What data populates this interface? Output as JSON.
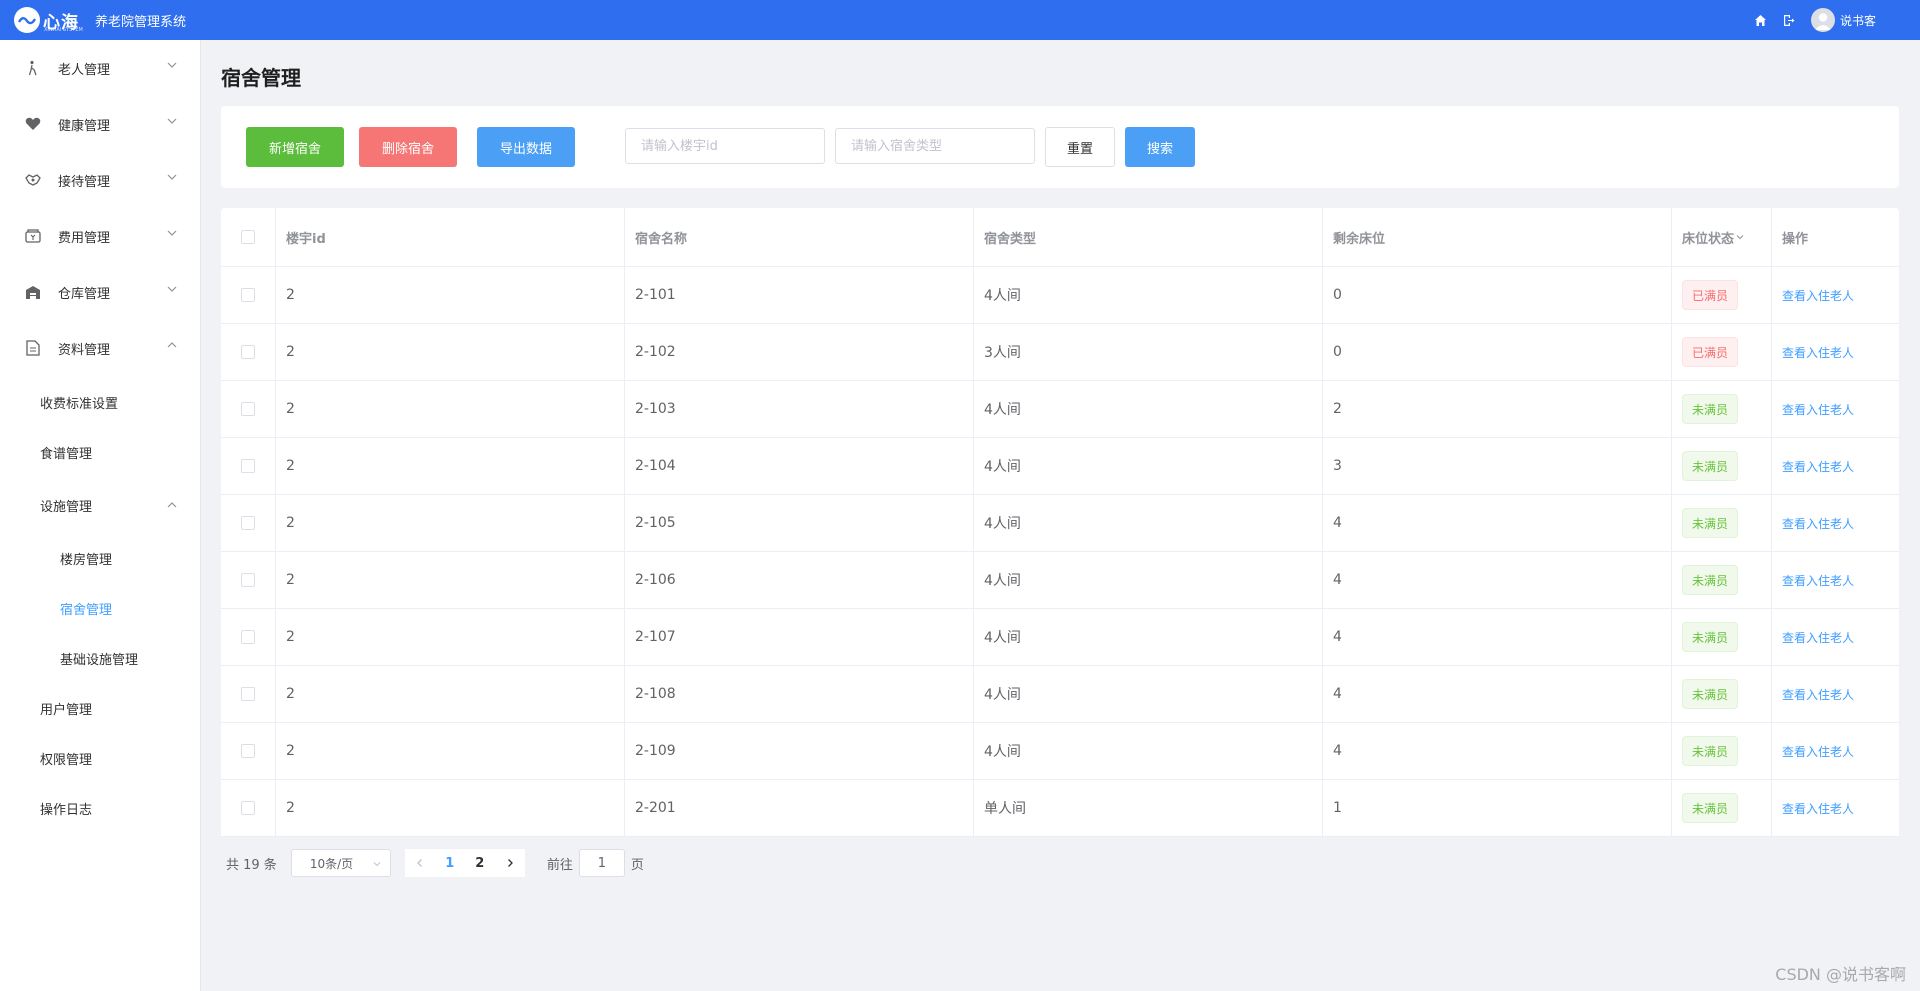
{
  "header": {
    "logo_text": "心海",
    "logo_sub": "XINHAI SYSTEM",
    "system_title": "养老院管理系统",
    "username": "说书客",
    "bg_color": "#2f6fef"
  },
  "sidebar": {
    "menus": [
      {
        "label": "老人管理",
        "icon": "elder-icon"
      },
      {
        "label": "健康管理",
        "icon": "heart-icon"
      },
      {
        "label": "接待管理",
        "icon": "handshake-icon"
      },
      {
        "label": "费用管理",
        "icon": "wallet-icon"
      },
      {
        "label": "仓库管理",
        "icon": "warehouse-icon"
      },
      {
        "label": "资料管理",
        "icon": "document-icon"
      }
    ],
    "sub_items": {
      "fee_standard": "收费标准设置",
      "recipe": "食谱管理",
      "facility": "设施管理",
      "building": "楼房管理",
      "dorm": "宿舍管理",
      "basic_facility": "基础设施管理",
      "user": "用户管理",
      "permission": "权限管理",
      "oplog": "操作日志"
    }
  },
  "page": {
    "title": "宿舍管理"
  },
  "toolbar": {
    "add_label": "新增宿舍",
    "delete_label": "删除宿舍",
    "export_label": "导出数据",
    "building_placeholder": "请输入楼宇id",
    "type_placeholder": "请输入宿舍类型",
    "reset_label": "重置",
    "search_label": "搜索"
  },
  "table": {
    "headers": {
      "building_id": "楼宇id",
      "name": "宿舍名称",
      "type": "宿舍类型",
      "beds_left": "剩余床位",
      "status": "床位状态",
      "action": "操作"
    },
    "action_label": "查看入住老人",
    "rows": [
      {
        "building_id": "2",
        "name": "2-101",
        "type": "4人间",
        "beds_left": "0",
        "status": "已满员",
        "full": true
      },
      {
        "building_id": "2",
        "name": "2-102",
        "type": "3人间",
        "beds_left": "0",
        "status": "已满员",
        "full": true
      },
      {
        "building_id": "2",
        "name": "2-103",
        "type": "4人间",
        "beds_left": "2",
        "status": "未满员",
        "full": false
      },
      {
        "building_id": "2",
        "name": "2-104",
        "type": "4人间",
        "beds_left": "3",
        "status": "未满员",
        "full": false
      },
      {
        "building_id": "2",
        "name": "2-105",
        "type": "4人间",
        "beds_left": "4",
        "status": "未满员",
        "full": false
      },
      {
        "building_id": "2",
        "name": "2-106",
        "type": "4人间",
        "beds_left": "4",
        "status": "未满员",
        "full": false
      },
      {
        "building_id": "2",
        "name": "2-107",
        "type": "4人间",
        "beds_left": "4",
        "status": "未满员",
        "full": false
      },
      {
        "building_id": "2",
        "name": "2-108",
        "type": "4人间",
        "beds_left": "4",
        "status": "未满员",
        "full": false
      },
      {
        "building_id": "2",
        "name": "2-109",
        "type": "4人间",
        "beds_left": "4",
        "status": "未满员",
        "full": false
      },
      {
        "building_id": "2",
        "name": "2-201",
        "type": "单人间",
        "beds_left": "1",
        "status": "未满员",
        "full": false
      }
    ]
  },
  "pagination": {
    "total_text": "共 19 条",
    "page_size": "10条/页",
    "pages": [
      "1",
      "2"
    ],
    "current_page": "1",
    "goto_prefix": "前往",
    "goto_suffix": "页",
    "goto_value": "1"
  },
  "watermark": "CSDN @说书客啊"
}
